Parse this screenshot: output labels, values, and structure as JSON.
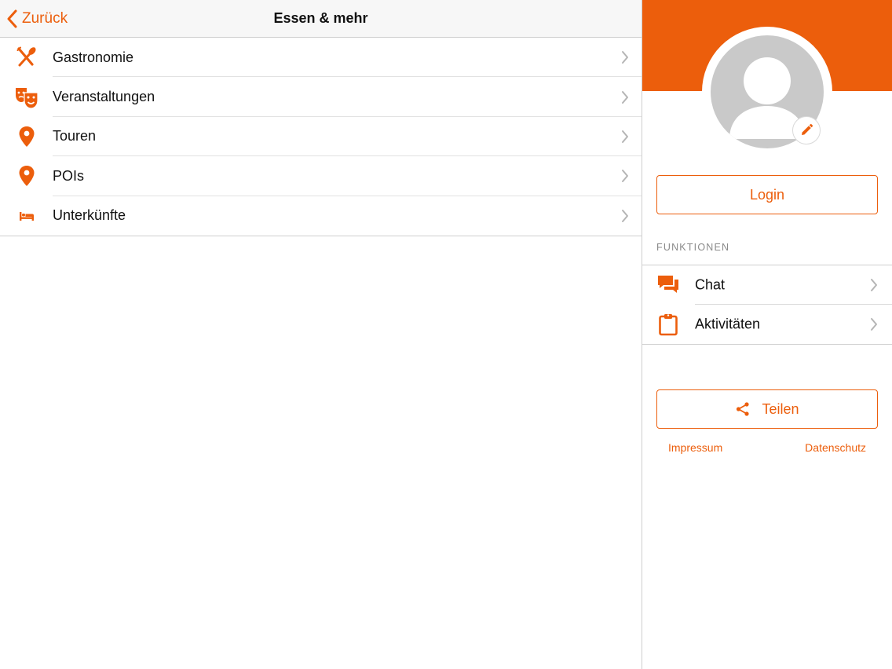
{
  "nav": {
    "back_label": "Zurück",
    "title": "Essen & mehr"
  },
  "menu": {
    "items": [
      {
        "label": "Gastronomie",
        "icon": "cutlery-icon"
      },
      {
        "label": "Veranstaltungen",
        "icon": "theater-masks-icon"
      },
      {
        "label": "Touren",
        "icon": "map-pin-icon"
      },
      {
        "label": "POIs",
        "icon": "map-pin-icon"
      },
      {
        "label": "Unterkünfte",
        "icon": "bed-icon"
      }
    ]
  },
  "profile": {
    "login_label": "Login",
    "section_title": "FUNKTIONEN",
    "functions": [
      {
        "label": "Chat",
        "icon": "chat-bubbles-icon"
      },
      {
        "label": "Aktivitäten",
        "icon": "clipboard-icon"
      }
    ],
    "share_label": "Teilen",
    "impressum_label": "Impressum",
    "datenschutz_label": "Datenschutz"
  },
  "colors": {
    "accent": "#ec5e0c",
    "avatar_grey": "#c9c9c9",
    "navbar_bg": "#f7f7f7"
  }
}
